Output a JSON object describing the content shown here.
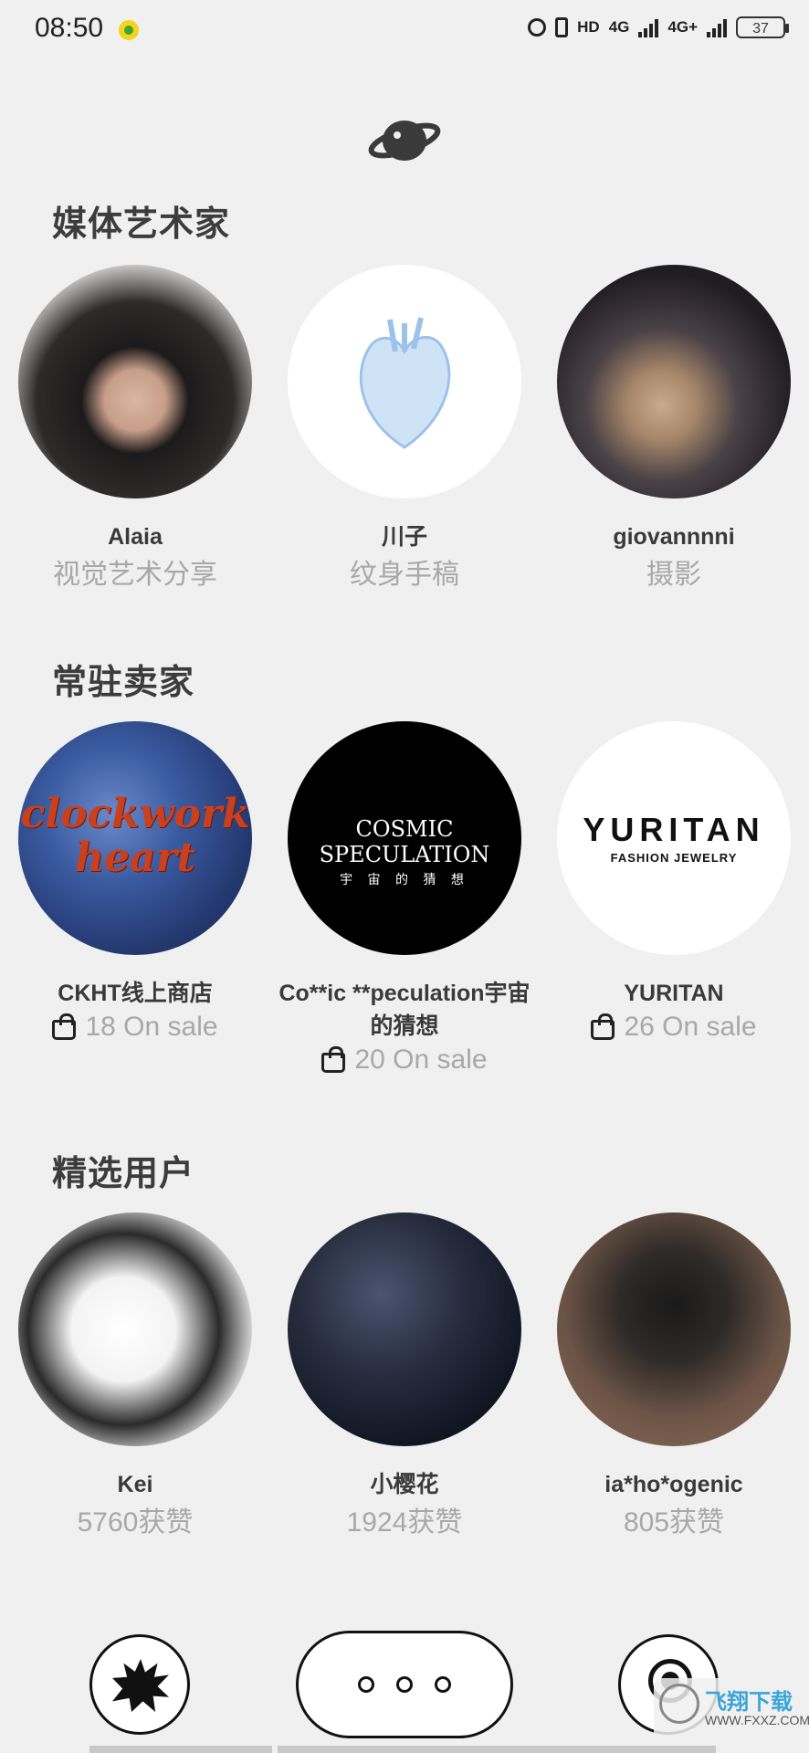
{
  "status_bar": {
    "time": "08:50",
    "hd": "HD",
    "net1": "4G",
    "net2": "4G+",
    "battery": "37"
  },
  "sections": {
    "media_artists": {
      "title": "媒体艺术家",
      "items": [
        {
          "name": "Alaia",
          "subtitle": "视觉艺术分享"
        },
        {
          "name": "川子",
          "subtitle": "纹身手稿"
        },
        {
          "name": "giovannnni",
          "subtitle": "摄影"
        }
      ]
    },
    "resident_sellers": {
      "title": "常驻卖家",
      "items": [
        {
          "name": "CKHT线上商店",
          "on_sale": "18 On sale",
          "logo_text": "clockwork heart"
        },
        {
          "name": "Co**ic **peculation宇宙的猜想",
          "on_sale": "20 On sale",
          "logo_text": "COSMIC SPECULATION",
          "logo_sub": "宇 宙 的 猜 想"
        },
        {
          "name": "YURITAN",
          "on_sale": "26 On sale",
          "logo_text": "YURITAN",
          "logo_sub": "FASHION JEWELRY"
        }
      ]
    },
    "featured_users": {
      "title": "精选用户",
      "items": [
        {
          "name": "Kei",
          "likes": "5760获赞"
        },
        {
          "name": "小樱花",
          "likes": "1924获赞"
        },
        {
          "name": "ia*ho*ogenic",
          "likes": "805获赞"
        }
      ]
    }
  },
  "bottom_nav": {
    "left_icon": "splat-icon",
    "center_icon": "more-dots-icon",
    "right_icon": "eye-icon"
  },
  "watermark": {
    "text": "飞翔下载",
    "url": "WWW.FXXZ.COM"
  },
  "colors": {
    "background": "#f0f0f0",
    "title": "#3c3c3c",
    "muted": "#a8a8a8"
  }
}
